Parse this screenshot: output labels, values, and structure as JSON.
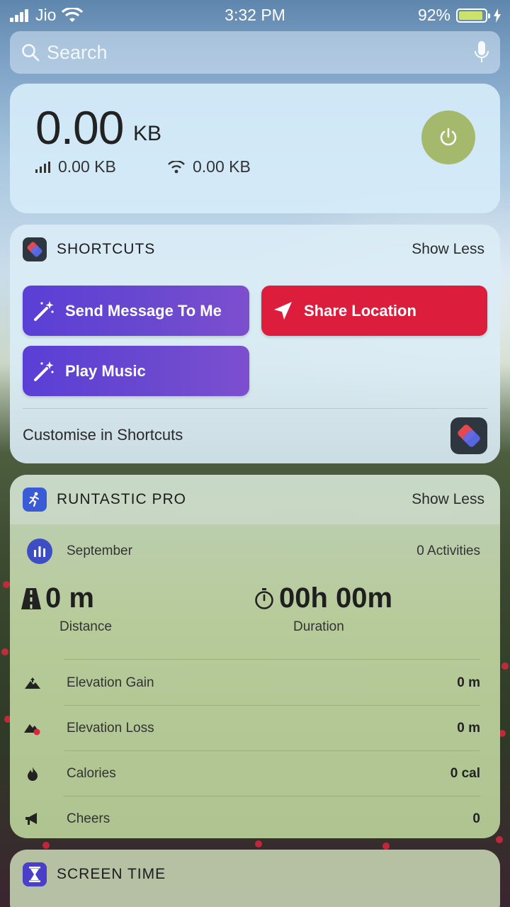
{
  "status_bar": {
    "carrier": "Jio",
    "time": "3:32 PM",
    "battery_percent": "92%",
    "battery_level": 0.92
  },
  "search": {
    "placeholder": "Search"
  },
  "data_widget": {
    "total_value": "0.00",
    "total_unit": "KB",
    "cellular": "0.00 KB",
    "wifi": "0.00 KB",
    "accent": "#a5b96d"
  },
  "shortcuts": {
    "title": "SHORTCUTS",
    "toggle": "Show Less",
    "buttons": [
      {
        "label": "Send Message To Me",
        "color": "#5a3fd6"
      },
      {
        "label": "Share Location",
        "color": "#dc1e3c"
      },
      {
        "label": "Play Music",
        "color": "#5a3fd6"
      }
    ],
    "customise": "Customise in Shortcuts"
  },
  "runtastic": {
    "title": "RUNTASTIC PRO",
    "toggle": "Show Less",
    "month": "September",
    "activities": "0 Activities",
    "distance_value": "0 m",
    "distance_label": "Distance",
    "duration_value": "00h 00m",
    "duration_label": "Duration",
    "rows": [
      {
        "label": "Elevation Gain",
        "value": "0 m",
        "icon": "elevation-gain-icon"
      },
      {
        "label": "Elevation Loss",
        "value": "0 m",
        "icon": "elevation-loss-icon"
      },
      {
        "label": "Calories",
        "value": "0 cal",
        "icon": "flame-icon"
      },
      {
        "label": "Cheers",
        "value": "0",
        "icon": "megaphone-icon"
      }
    ]
  },
  "screen_time": {
    "title": "SCREEN TIME"
  }
}
